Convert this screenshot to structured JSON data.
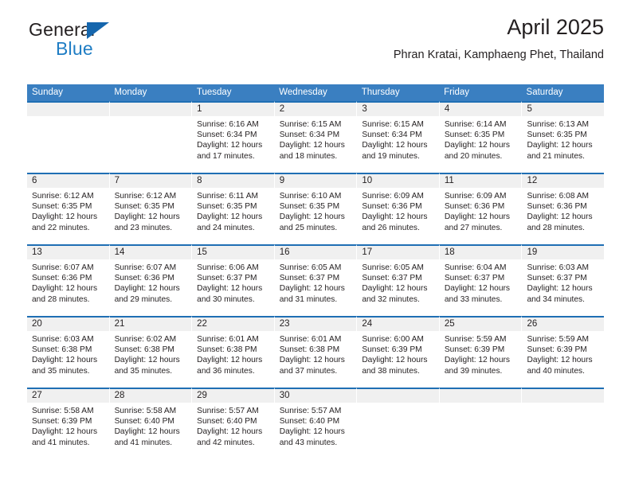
{
  "brand": {
    "name_top": "General",
    "name_bottom": "Blue",
    "triangle_color": "#1566ad",
    "blue_color": "#1f7dc4"
  },
  "header": {
    "title": "April 2025",
    "subtitle": "Phran Kratai, Kamphaeng Phet, Thailand"
  },
  "theme": {
    "header_band": "#3a7fc1",
    "row_rule": "#1f6fb4",
    "daynum_band": "#f0f0f0"
  },
  "weekdays": [
    "Sunday",
    "Monday",
    "Tuesday",
    "Wednesday",
    "Thursday",
    "Friday",
    "Saturday"
  ],
  "weeks": [
    [
      {
        "day": "",
        "sunrise": "",
        "sunset": "",
        "daylight1": "",
        "daylight2": ""
      },
      {
        "day": "",
        "sunrise": "",
        "sunset": "",
        "daylight1": "",
        "daylight2": ""
      },
      {
        "day": "1",
        "sunrise": "Sunrise: 6:16 AM",
        "sunset": "Sunset: 6:34 PM",
        "daylight1": "Daylight: 12 hours",
        "daylight2": "and 17 minutes."
      },
      {
        "day": "2",
        "sunrise": "Sunrise: 6:15 AM",
        "sunset": "Sunset: 6:34 PM",
        "daylight1": "Daylight: 12 hours",
        "daylight2": "and 18 minutes."
      },
      {
        "day": "3",
        "sunrise": "Sunrise: 6:15 AM",
        "sunset": "Sunset: 6:34 PM",
        "daylight1": "Daylight: 12 hours",
        "daylight2": "and 19 minutes."
      },
      {
        "day": "4",
        "sunrise": "Sunrise: 6:14 AM",
        "sunset": "Sunset: 6:35 PM",
        "daylight1": "Daylight: 12 hours",
        "daylight2": "and 20 minutes."
      },
      {
        "day": "5",
        "sunrise": "Sunrise: 6:13 AM",
        "sunset": "Sunset: 6:35 PM",
        "daylight1": "Daylight: 12 hours",
        "daylight2": "and 21 minutes."
      }
    ],
    [
      {
        "day": "6",
        "sunrise": "Sunrise: 6:12 AM",
        "sunset": "Sunset: 6:35 PM",
        "daylight1": "Daylight: 12 hours",
        "daylight2": "and 22 minutes."
      },
      {
        "day": "7",
        "sunrise": "Sunrise: 6:12 AM",
        "sunset": "Sunset: 6:35 PM",
        "daylight1": "Daylight: 12 hours",
        "daylight2": "and 23 minutes."
      },
      {
        "day": "8",
        "sunrise": "Sunrise: 6:11 AM",
        "sunset": "Sunset: 6:35 PM",
        "daylight1": "Daylight: 12 hours",
        "daylight2": "and 24 minutes."
      },
      {
        "day": "9",
        "sunrise": "Sunrise: 6:10 AM",
        "sunset": "Sunset: 6:35 PM",
        "daylight1": "Daylight: 12 hours",
        "daylight2": "and 25 minutes."
      },
      {
        "day": "10",
        "sunrise": "Sunrise: 6:09 AM",
        "sunset": "Sunset: 6:36 PM",
        "daylight1": "Daylight: 12 hours",
        "daylight2": "and 26 minutes."
      },
      {
        "day": "11",
        "sunrise": "Sunrise: 6:09 AM",
        "sunset": "Sunset: 6:36 PM",
        "daylight1": "Daylight: 12 hours",
        "daylight2": "and 27 minutes."
      },
      {
        "day": "12",
        "sunrise": "Sunrise: 6:08 AM",
        "sunset": "Sunset: 6:36 PM",
        "daylight1": "Daylight: 12 hours",
        "daylight2": "and 28 minutes."
      }
    ],
    [
      {
        "day": "13",
        "sunrise": "Sunrise: 6:07 AM",
        "sunset": "Sunset: 6:36 PM",
        "daylight1": "Daylight: 12 hours",
        "daylight2": "and 28 minutes."
      },
      {
        "day": "14",
        "sunrise": "Sunrise: 6:07 AM",
        "sunset": "Sunset: 6:36 PM",
        "daylight1": "Daylight: 12 hours",
        "daylight2": "and 29 minutes."
      },
      {
        "day": "15",
        "sunrise": "Sunrise: 6:06 AM",
        "sunset": "Sunset: 6:37 PM",
        "daylight1": "Daylight: 12 hours",
        "daylight2": "and 30 minutes."
      },
      {
        "day": "16",
        "sunrise": "Sunrise: 6:05 AM",
        "sunset": "Sunset: 6:37 PM",
        "daylight1": "Daylight: 12 hours",
        "daylight2": "and 31 minutes."
      },
      {
        "day": "17",
        "sunrise": "Sunrise: 6:05 AM",
        "sunset": "Sunset: 6:37 PM",
        "daylight1": "Daylight: 12 hours",
        "daylight2": "and 32 minutes."
      },
      {
        "day": "18",
        "sunrise": "Sunrise: 6:04 AM",
        "sunset": "Sunset: 6:37 PM",
        "daylight1": "Daylight: 12 hours",
        "daylight2": "and 33 minutes."
      },
      {
        "day": "19",
        "sunrise": "Sunrise: 6:03 AM",
        "sunset": "Sunset: 6:37 PM",
        "daylight1": "Daylight: 12 hours",
        "daylight2": "and 34 minutes."
      }
    ],
    [
      {
        "day": "20",
        "sunrise": "Sunrise: 6:03 AM",
        "sunset": "Sunset: 6:38 PM",
        "daylight1": "Daylight: 12 hours",
        "daylight2": "and 35 minutes."
      },
      {
        "day": "21",
        "sunrise": "Sunrise: 6:02 AM",
        "sunset": "Sunset: 6:38 PM",
        "daylight1": "Daylight: 12 hours",
        "daylight2": "and 35 minutes."
      },
      {
        "day": "22",
        "sunrise": "Sunrise: 6:01 AM",
        "sunset": "Sunset: 6:38 PM",
        "daylight1": "Daylight: 12 hours",
        "daylight2": "and 36 minutes."
      },
      {
        "day": "23",
        "sunrise": "Sunrise: 6:01 AM",
        "sunset": "Sunset: 6:38 PM",
        "daylight1": "Daylight: 12 hours",
        "daylight2": "and 37 minutes."
      },
      {
        "day": "24",
        "sunrise": "Sunrise: 6:00 AM",
        "sunset": "Sunset: 6:39 PM",
        "daylight1": "Daylight: 12 hours",
        "daylight2": "and 38 minutes."
      },
      {
        "day": "25",
        "sunrise": "Sunrise: 5:59 AM",
        "sunset": "Sunset: 6:39 PM",
        "daylight1": "Daylight: 12 hours",
        "daylight2": "and 39 minutes."
      },
      {
        "day": "26",
        "sunrise": "Sunrise: 5:59 AM",
        "sunset": "Sunset: 6:39 PM",
        "daylight1": "Daylight: 12 hours",
        "daylight2": "and 40 minutes."
      }
    ],
    [
      {
        "day": "27",
        "sunrise": "Sunrise: 5:58 AM",
        "sunset": "Sunset: 6:39 PM",
        "daylight1": "Daylight: 12 hours",
        "daylight2": "and 41 minutes."
      },
      {
        "day": "28",
        "sunrise": "Sunrise: 5:58 AM",
        "sunset": "Sunset: 6:40 PM",
        "daylight1": "Daylight: 12 hours",
        "daylight2": "and 41 minutes."
      },
      {
        "day": "29",
        "sunrise": "Sunrise: 5:57 AM",
        "sunset": "Sunset: 6:40 PM",
        "daylight1": "Daylight: 12 hours",
        "daylight2": "and 42 minutes."
      },
      {
        "day": "30",
        "sunrise": "Sunrise: 5:57 AM",
        "sunset": "Sunset: 6:40 PM",
        "daylight1": "Daylight: 12 hours",
        "daylight2": "and 43 minutes."
      },
      {
        "day": "",
        "sunrise": "",
        "sunset": "",
        "daylight1": "",
        "daylight2": ""
      },
      {
        "day": "",
        "sunrise": "",
        "sunset": "",
        "daylight1": "",
        "daylight2": ""
      },
      {
        "day": "",
        "sunrise": "",
        "sunset": "",
        "daylight1": "",
        "daylight2": ""
      }
    ]
  ]
}
